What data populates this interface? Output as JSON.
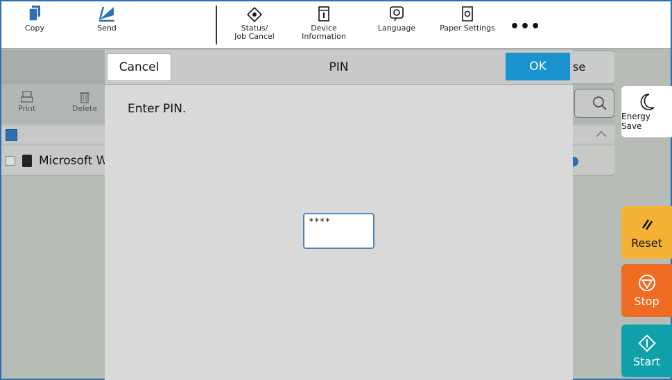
{
  "toolbar": {
    "copy": "Copy",
    "send": "Send",
    "status_line1": "Status/",
    "status_line2": "Job Cancel",
    "device_line1": "Device",
    "device_line2": "Information",
    "language": "Language",
    "paper_settings": "Paper Settings",
    "more": "•••"
  },
  "background": {
    "close_label": "se",
    "print_label": "Print",
    "delete_label": "Delete",
    "row_label": "Microsoft W"
  },
  "side": {
    "energy_saver": "Energy Save",
    "reset": "Reset",
    "stop": "Stop",
    "start": "Start"
  },
  "dialog": {
    "cancel": "Cancel",
    "title": "PIN",
    "ok": "OK",
    "prompt": "Enter PIN.",
    "pin_value": "****"
  },
  "colors": {
    "ok": "#1a93cf",
    "reset": "#f5b335",
    "stop": "#f06b22",
    "start": "#10a0ac",
    "accent": "#2c6fb5"
  }
}
